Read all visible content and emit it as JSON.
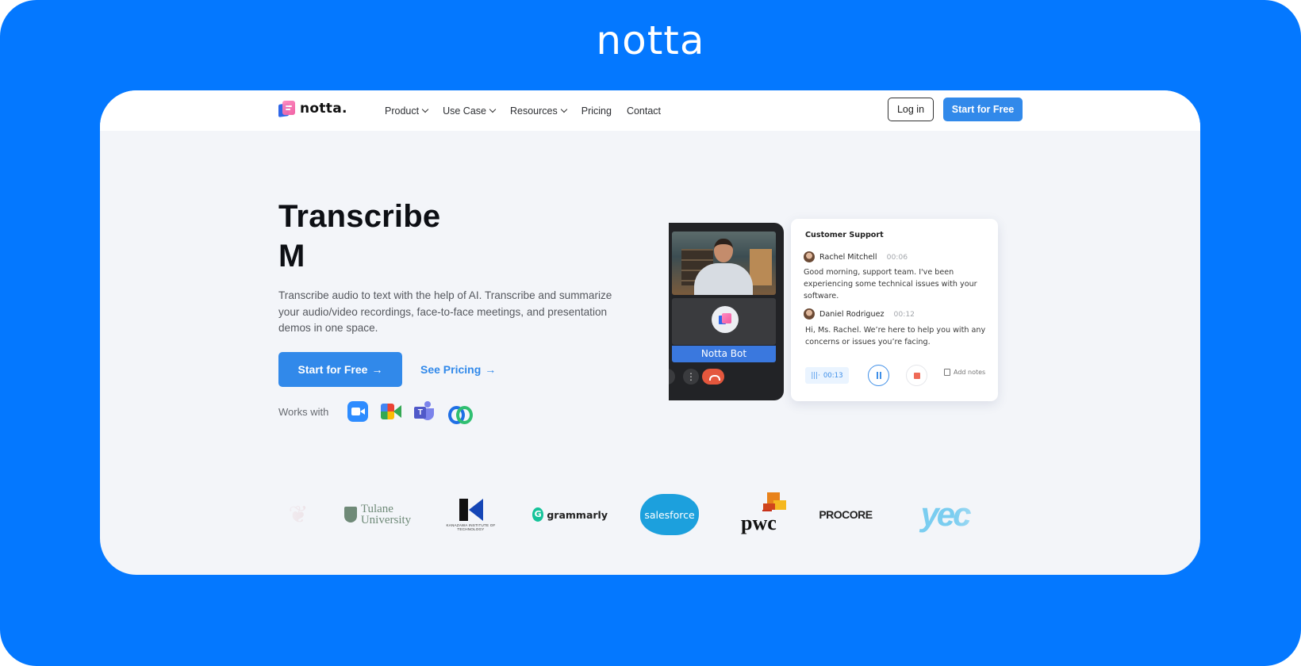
{
  "brand": {
    "top_logo": "notta",
    "nav_logo": "notta."
  },
  "nav": {
    "items": [
      {
        "label": "Product",
        "has_dropdown": true
      },
      {
        "label": "Use Case",
        "has_dropdown": true
      },
      {
        "label": "Resources",
        "has_dropdown": true
      },
      {
        "label": "Pricing",
        "has_dropdown": false
      },
      {
        "label": "Contact",
        "has_dropdown": false
      }
    ],
    "login_label": "Log in",
    "start_label": "Start for Free"
  },
  "hero": {
    "title_line1": "Transcribe",
    "title_line2": "M",
    "description": "Transcribe audio to text with the help of AI. Transcribe and summarize your audio/video recordings, face-to-face meetings, and presentation demos in one space.",
    "cta_label": "Start for Free",
    "cta_arrow": "→",
    "pricing_label": "See Pricing",
    "pricing_arrow": "→",
    "works_with_label": "Works with",
    "integrations": [
      "zoom-icon",
      "google-meet-icon",
      "microsoft-teams-icon",
      "webex-icon"
    ]
  },
  "call": {
    "bot_label": "Notta Bot"
  },
  "transcript": {
    "title": "Customer Support",
    "entries": [
      {
        "speaker": "Rachel Mitchell",
        "time": "00:06",
        "text": "Good morning, support team. I've been experiencing some technical issues with your software."
      },
      {
        "speaker": "Daniel Rodriguez",
        "time": "00:12",
        "text": "Hi, Ms. Rachel. We’re here to help you with any concerns or issues you’re facing."
      }
    ],
    "recording_time": "00:13",
    "recording_icon": "|||·",
    "add_notes_label": "Add notes"
  },
  "logos": {
    "items": [
      "Tulane University",
      "Kanazawa Institute of Technology",
      "grammarly",
      "salesforce",
      "pwc",
      "PROCORE",
      "yec"
    ],
    "tulane_line1": "Tulane",
    "tulane_line2": "University",
    "kanazawa_text": "KANAZAWA INSTITUTE OF TECHNOLOGY",
    "grammarly_mark": "G",
    "grammarly": "grammarly",
    "salesforce": "salesforce",
    "pwc": "pwc",
    "procore": "PROCORE",
    "yec": "yec"
  },
  "colors": {
    "frame_blue": "#0478ff",
    "primary": "#3189ea",
    "page_bg": "#f3f5f9",
    "end_call": "#e4573d"
  }
}
